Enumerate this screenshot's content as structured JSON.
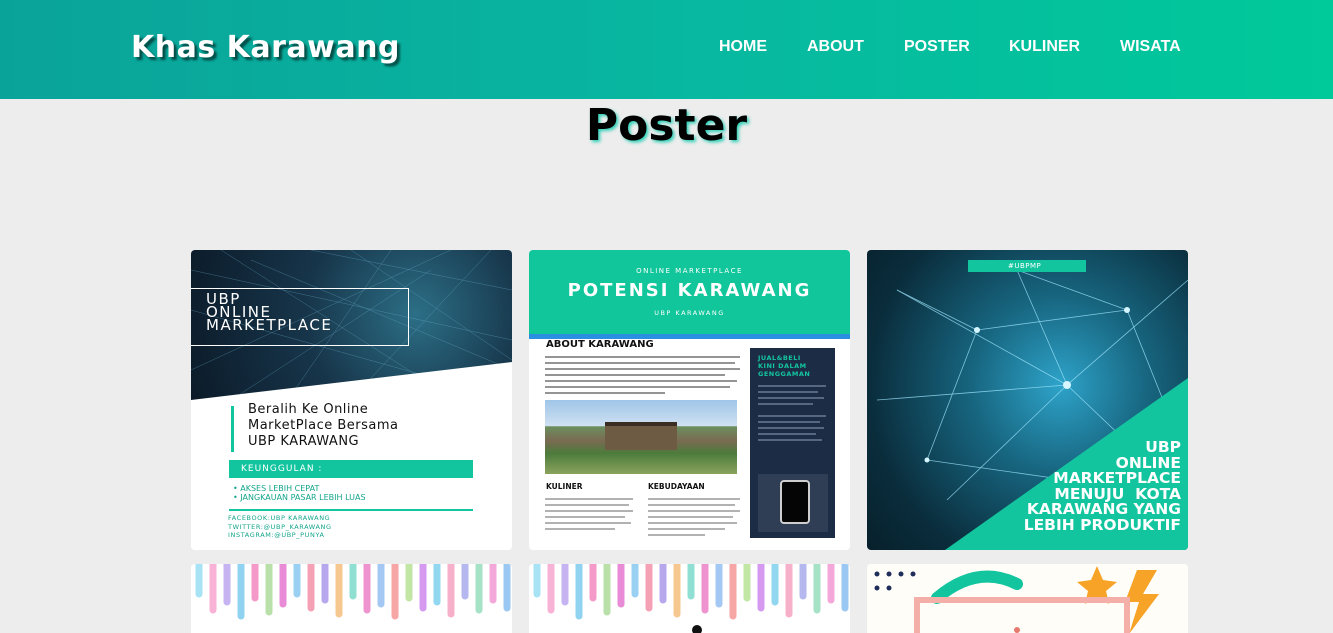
{
  "header": {
    "brand": "Khas Karawang",
    "nav": [
      "HOME",
      "ABOUT",
      "POSTER",
      "KULINER",
      "WISATA"
    ]
  },
  "main": {
    "title": "Poster"
  },
  "posters": [
    {
      "box_text": "UBP\nONLINE\nMARKETPLACE",
      "heading": "Beralih Ke Online\nMarketPlace Bersama\nUBP KARAWANG",
      "advantage_label": "KEUNGGULAN :",
      "bullets": "• AKSES LEBIH CEPAT\n• JANGKAUAN PASAR LEBIH LUAS",
      "social": "FACEBOOK:UBP KARAWANG\nTWITTER:@UBP_KARAWANG\nINSTAGRAM:@UBP_PUNYA"
    },
    {
      "kicker": "ONLINE MARKETPLACE",
      "title": "POTENSI KARAWANG",
      "sub": "UBP KARAWANG",
      "about": "ABOUT KARAWANG",
      "side_title": "JUAL&BELI\nKINI DALAM\nGENGGAMAN",
      "col1": "KULINER",
      "col2": "KEBUDAYAAN"
    },
    {
      "tag": "#UBPMP",
      "text": "UBP\nONLINE\nMARKETPLACE\nMENUJU  KOTA\nKARAWANG YANG\nLEBIH PRODUKTIF"
    }
  ],
  "colors": {
    "header_start": "#0aa39a",
    "header_end": "#00c99a",
    "accent": "#13c59f",
    "background": "#ededed"
  }
}
